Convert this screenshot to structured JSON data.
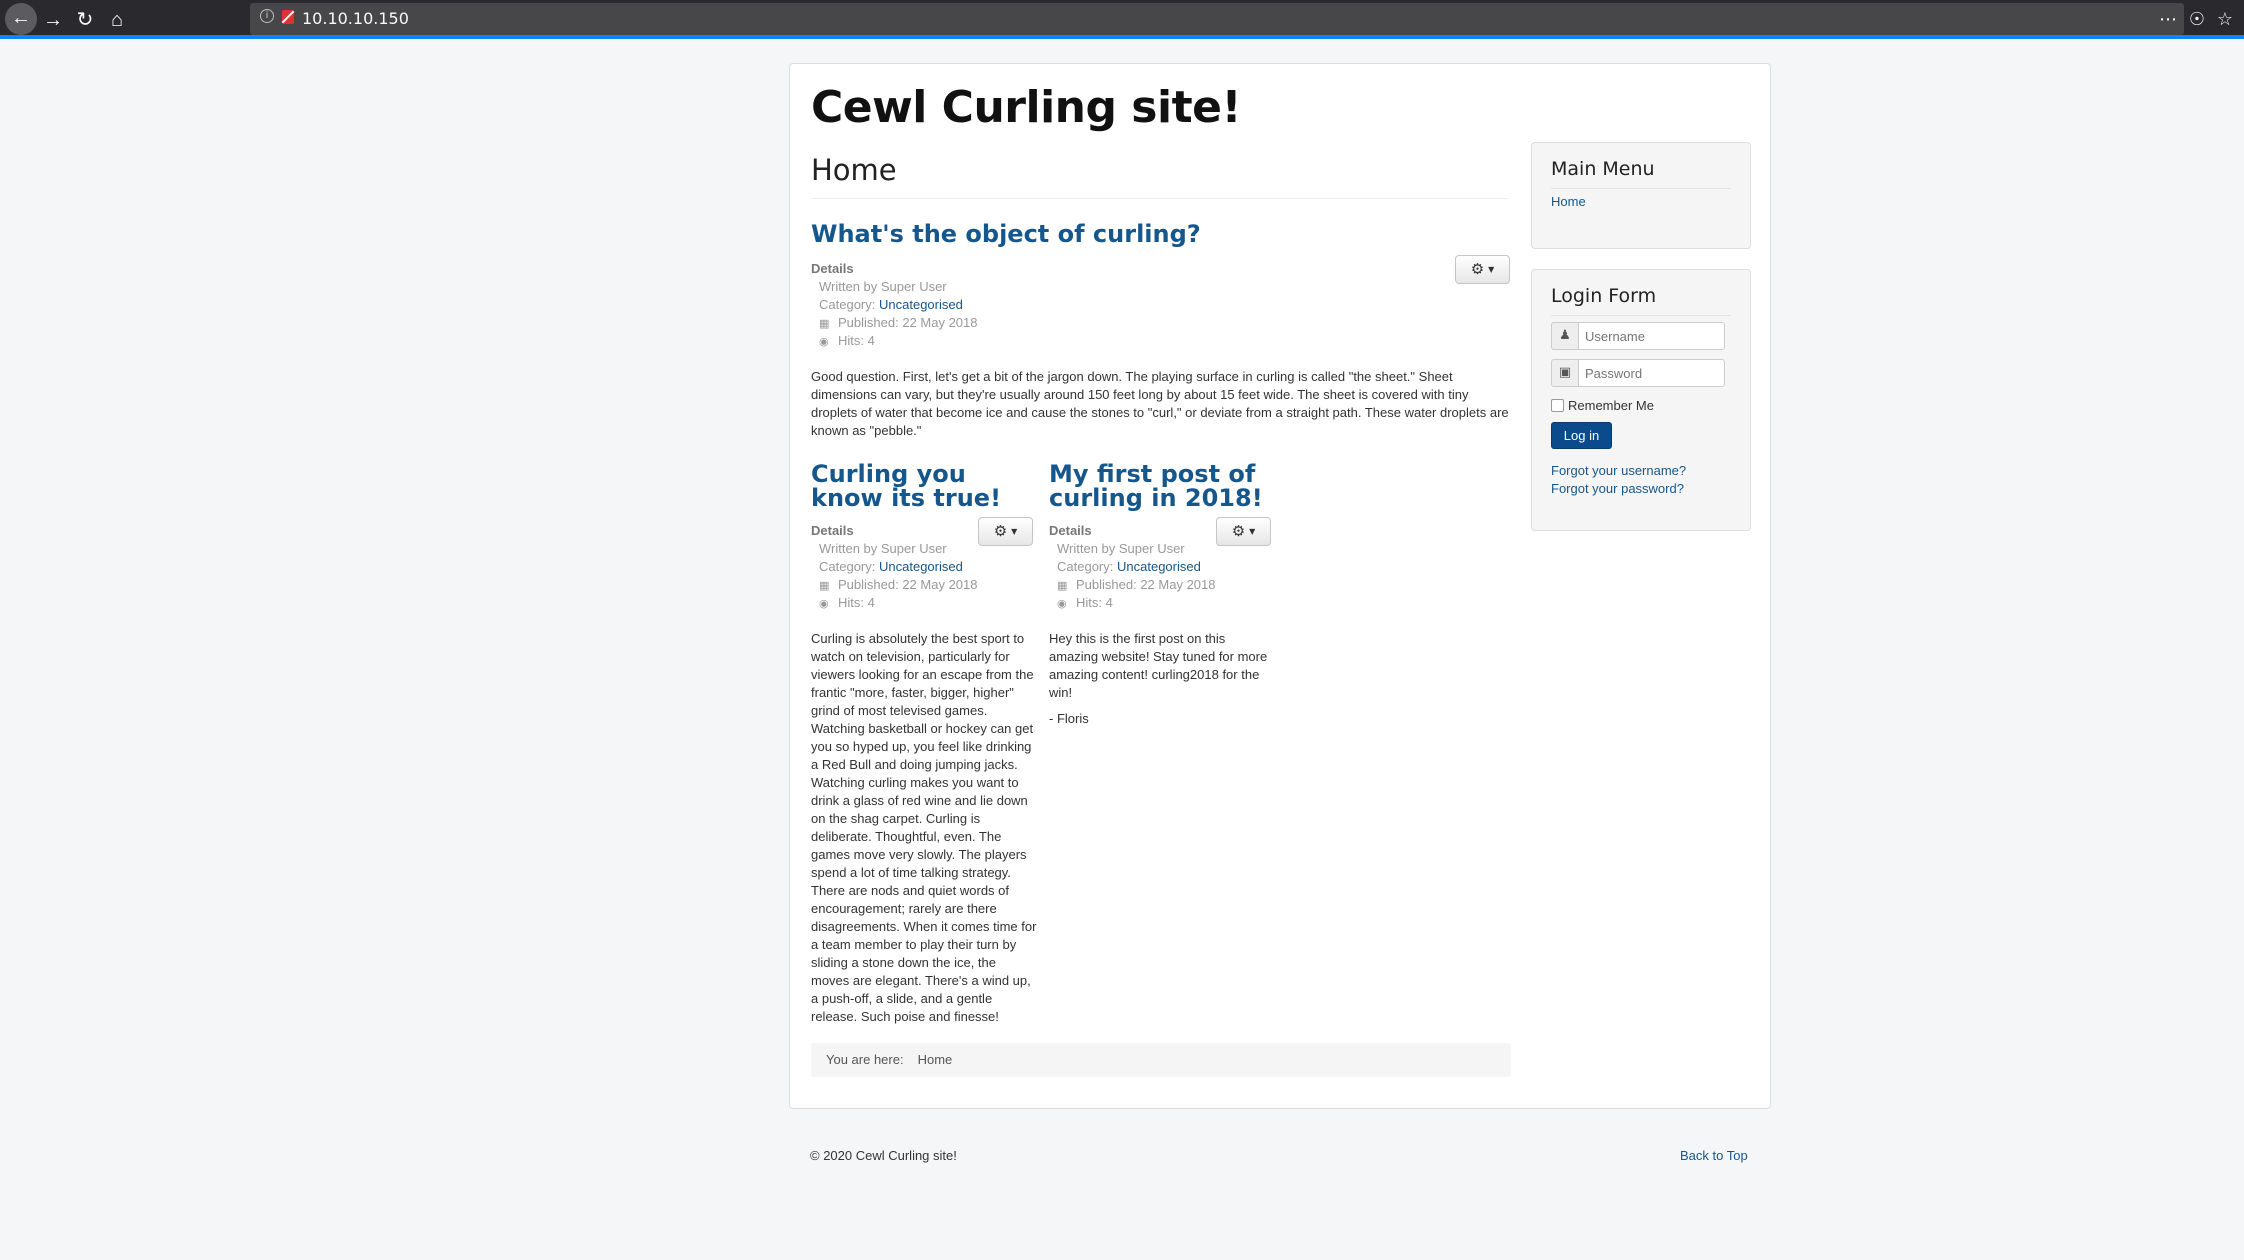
{
  "browser": {
    "url": "10.10.10.150",
    "info_glyph": "i",
    "icons": [
      "back-arrow-icon",
      "forward-arrow-icon",
      "reload-icon",
      "home-icon",
      "info-icon",
      "insecure-lock-icon",
      "more-actions-icon",
      "pocket-icon",
      "bookmark-star-icon"
    ]
  },
  "site": {
    "title": "Cewl Curling site!",
    "page_heading": "Home",
    "link_color": "#15578c",
    "accent_button_color": "#0b4b8c"
  },
  "articles": [
    {
      "title": "What's the object of curling?",
      "details_label": "Details",
      "written_by": "Written by Super User",
      "category_label": "Category:",
      "category": "Uncategorised",
      "published": "Published: 22 May 2018",
      "hits": "Hits: 4",
      "body": "Good question. First, let's get a bit of the jargon down. The playing surface in curling is called \"the sheet.\" Sheet dimensions can vary, but they're usually around 150 feet long by about 15 feet wide. The sheet is covered with tiny droplets of water that become ice and cause the stones to \"curl,\" or deviate from a straight path. These water droplets are known as \"pebble.\""
    },
    {
      "title": "Curling you know its true!",
      "details_label": "Details",
      "written_by": "Written by Super User",
      "category_label": "Category:",
      "category": "Uncategorised",
      "published": "Published: 22 May 2018",
      "hits": "Hits: 4",
      "body": "Curling is absolutely the best sport to watch on television, particularly for viewers looking for an escape from the frantic \"more, faster, bigger, higher\" grind of most televised games. Watching basketball or hockey can get you so hyped up, you feel like drinking a Red Bull and doing jumping jacks. Watching curling makes you want to drink a glass of red wine and lie down on the shag carpet. Curling is deliberate. Thoughtful, even. The games move very slowly. The players spend a lot of time talking strategy. There are nods and quiet words of encouragement; rarely are there disagreements. When it comes time for a team member to play their turn by sliding a stone down the ice, the moves are elegant. There's a wind up, a push-off, a slide, and a gentle release. Such poise and finesse!"
    },
    {
      "title": "My first post of curling in 2018!",
      "details_label": "Details",
      "written_by": "Written by Super User",
      "category_label": "Category:",
      "category": "Uncategorised",
      "published": "Published: 22 May 2018",
      "hits": "Hits: 4",
      "body": "Hey this is the first post on this amazing website! Stay tuned for more amazing content! curling2018 for the win!",
      "signature": "- Floris"
    }
  ],
  "breadcrumb": {
    "label": "You are here:",
    "current": "Home"
  },
  "sidebar": {
    "main_menu": {
      "title": "Main Menu",
      "items": [
        "Home"
      ]
    },
    "login_form": {
      "title": "Login Form",
      "username_placeholder": "Username",
      "password_placeholder": "Password",
      "remember_label": "Remember Me",
      "login_button": "Log in",
      "forgot_username": "Forgot your username?",
      "forgot_password": "Forgot your password?"
    }
  },
  "footer": {
    "copyright": "© 2020 Cewl Curling site!",
    "back_to_top": "Back to Top"
  }
}
